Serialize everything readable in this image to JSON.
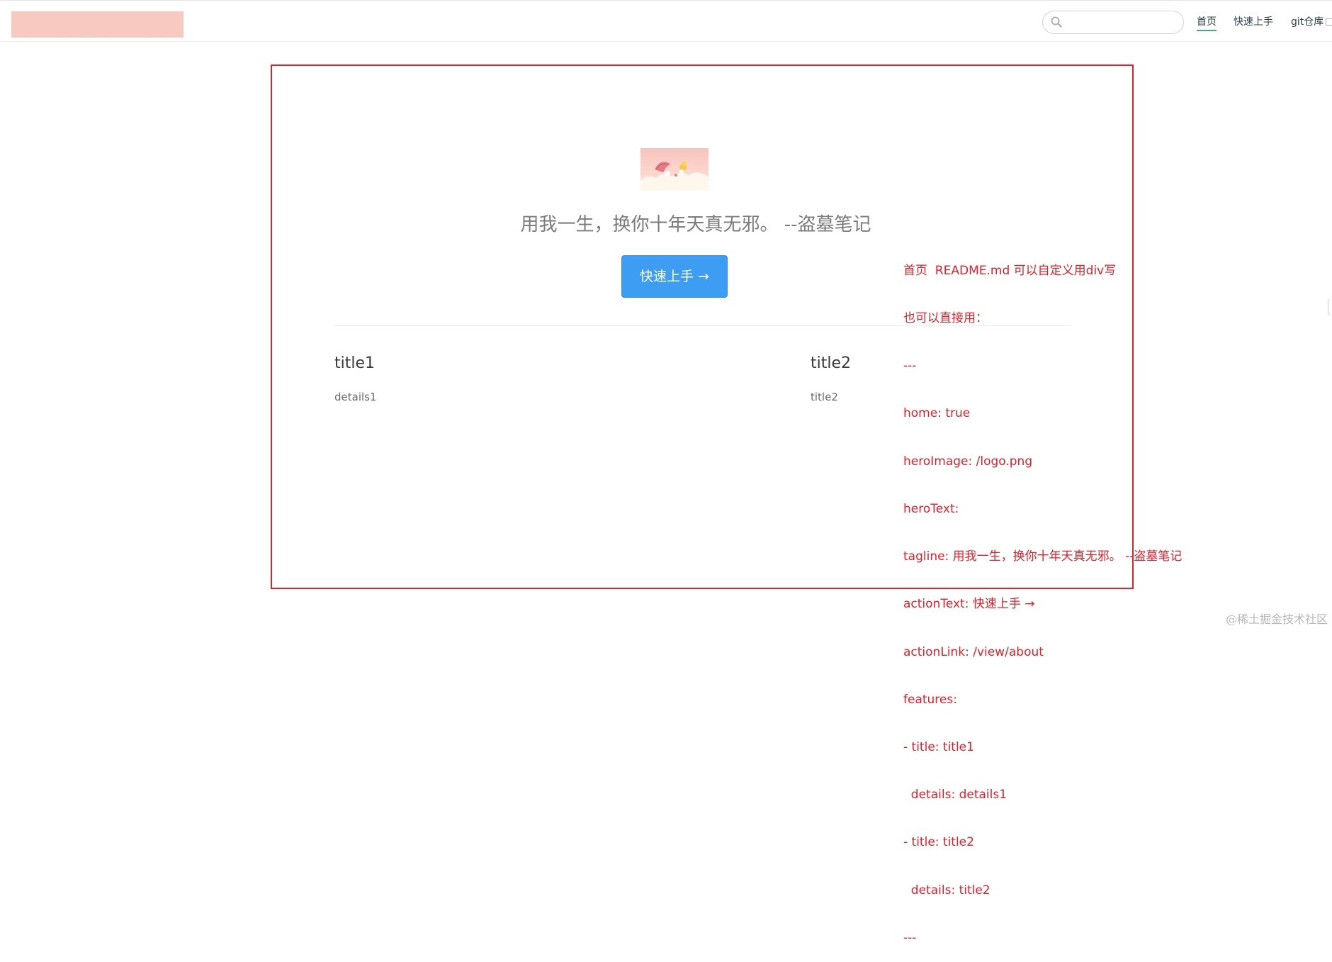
{
  "navbar": {
    "search": {
      "placeholder": "",
      "value": ""
    },
    "links": [
      {
        "label": "首页",
        "active": true
      },
      {
        "label": "快速上手",
        "active": false
      },
      {
        "label": "git仓库",
        "active": false
      }
    ]
  },
  "hero": {
    "tagline": "用我一生，换你十年天真无邪。 --盗墓笔记",
    "action_text": "快速上手 →"
  },
  "features": [
    {
      "title": "title1",
      "details": "details1"
    },
    {
      "title": "title2",
      "details": "title2"
    }
  ],
  "annotation": {
    "lines": [
      "首页  README.md 可以自定义用div写",
      "也可以直接用：",
      "---",
      "home: true",
      "heroImage: /logo.png",
      "heroText:",
      "tagline: 用我一生，换你十年天真无邪。 --盗墓笔记",
      "actionText: 快速上手 →",
      "actionLink: /view/about",
      "features:",
      "- title: title1",
      "  details: details1",
      "- title: title2",
      "  details: title2",
      "---"
    ]
  },
  "watermark": "@稀土掘金技术社区",
  "colors": {
    "accent_underline": "#3eaf7c",
    "action_button": "#3d9df3",
    "annotation": "#e0202a",
    "logo_placeholder": "#f7c9c1"
  },
  "icons": {
    "search": "magnifier-icon",
    "external_link": "external-link-icon"
  }
}
